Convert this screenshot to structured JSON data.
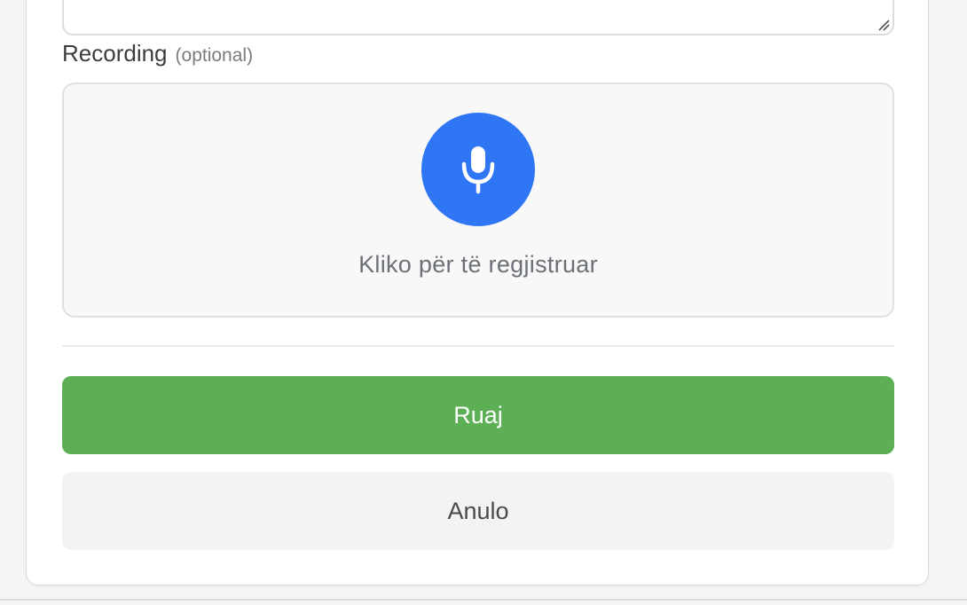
{
  "form": {
    "recording": {
      "label": "Recording",
      "optional_hint": "(optional)",
      "hint": "Kliko për të regjistruar"
    },
    "actions": {
      "save_label": "Ruaj",
      "cancel_label": "Anulo"
    }
  },
  "icons": {
    "mic": "microphone-icon",
    "resize": "resize-grip-icon"
  },
  "colors": {
    "accent_blue": "#2f76f5",
    "save_green": "#5daf55",
    "cancel_bg": "#f3f3f3"
  }
}
